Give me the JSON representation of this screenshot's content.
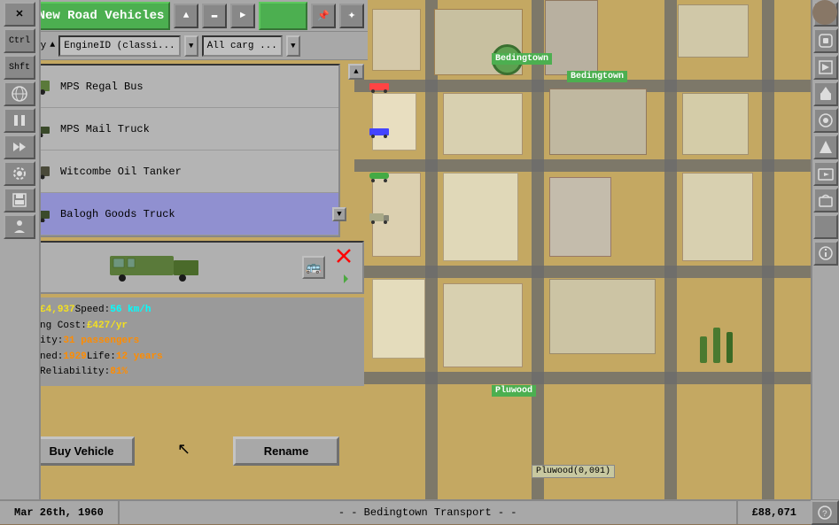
{
  "window": {
    "title": "New Road Vehicles",
    "close_btn": "×",
    "arrow_up": "▲",
    "arrow_down": "▼",
    "arrow_left": "◄",
    "arrow_right": "►",
    "pin_btn": "📌"
  },
  "sort_bar": {
    "label": "Sort by",
    "sort_field": "EngineID (classi...",
    "sort_arrow": "▲",
    "dropdown_arrow": "▼",
    "cargo_filter": "All carg ...",
    "cargo_arrow": "▼"
  },
  "vehicles": [
    {
      "name": "MPS Regal Bus",
      "type": "bus"
    },
    {
      "name": "MPS Mail Truck",
      "type": "truck"
    },
    {
      "name": "Witcombe Oil Tanker",
      "type": "oil"
    },
    {
      "name": "Balogh Goods Truck",
      "type": "truck",
      "selected": true
    }
  ],
  "stats": {
    "cost_label": "Cost: ",
    "cost_value": "£4,937",
    "speed_label": " Speed: ",
    "speed_value": "56 km/h",
    "running_label": "Running Cost: ",
    "running_value": "£427/yr",
    "capacity_label": "Capacity: ",
    "capacity_value": "31 passengers",
    "designed_label": "Designed: ",
    "designed_value": "1929",
    "life_label": " Life: ",
    "life_value": "12 years",
    "reliability_label": "Max. Reliability: ",
    "reliability_value": "81%"
  },
  "buttons": {
    "buy": "Buy Vehicle",
    "rename": "Rename"
  },
  "status_bar": {
    "date": "Mar 26th, 1960",
    "company": "- - Bedingtown Transport - -",
    "money": "£88,071"
  },
  "map": {
    "city1_name": "Bedingtown",
    "city2_name": "Bedingtown",
    "city3_name": "Pluwood",
    "city4_popup": "Pluwood(0,091)"
  },
  "right_sidebar": {
    "icons": [
      "🗺",
      "⚙",
      "💾",
      "🔊",
      "⏩",
      "⚙",
      "💾",
      "🚢",
      "🎮",
      "❓"
    ]
  },
  "scrollbar": {
    "up": "▲",
    "down": "▼"
  }
}
